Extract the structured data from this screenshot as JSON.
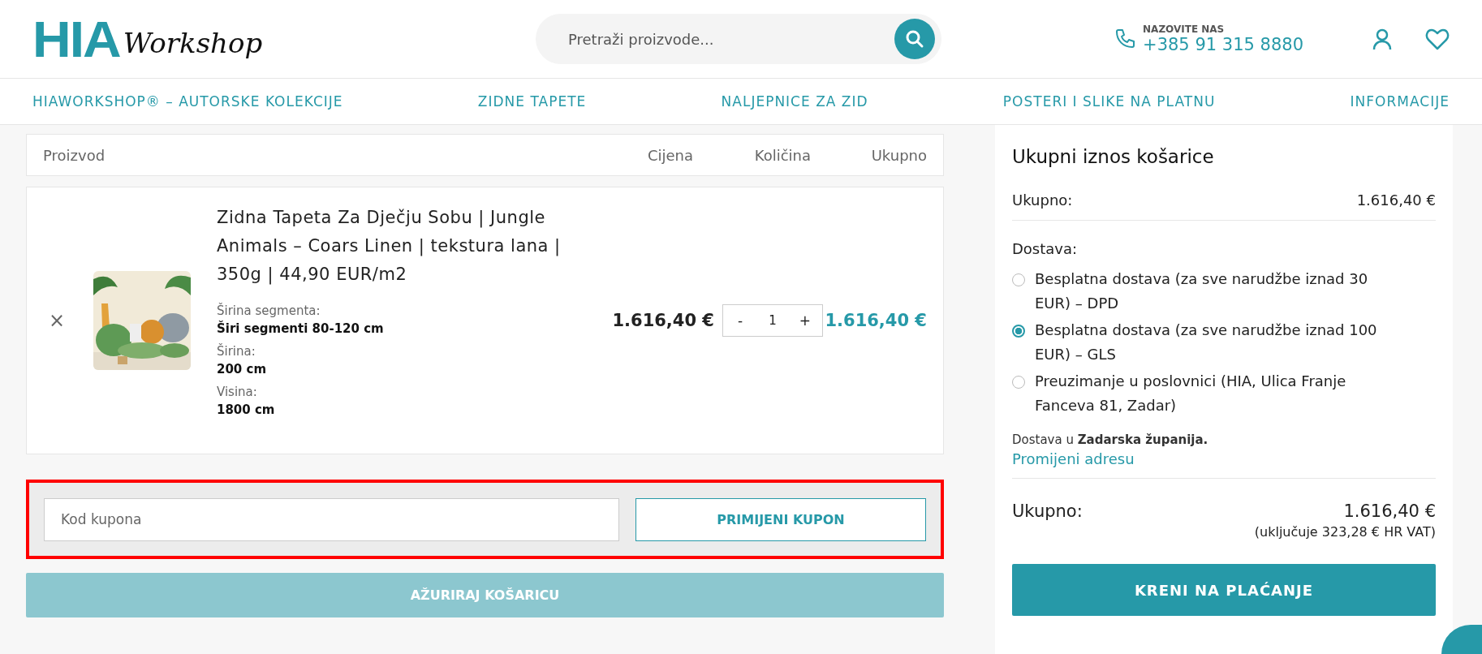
{
  "header": {
    "logo": {
      "main": "HIA",
      "script": "Workshop"
    },
    "search": {
      "placeholder": "Pretraži proizvode..."
    },
    "phone": {
      "label": "NAZOVITE NAS",
      "number": "+385 91 315 8880"
    }
  },
  "nav": [
    "HIAWORKSHOP® – AUTORSKE KOLEKCIJE",
    "ZIDNE TAPETE",
    "NALJEPNICE ZA ZID",
    "POSTERI I SLIKE NA PLATNU",
    "INFORMACIJE"
  ],
  "cart": {
    "columns": [
      "Proizvod",
      "Cijena",
      "Količina",
      "Ukupno"
    ],
    "items": [
      {
        "remove": "×",
        "title": "Zidna Tapeta Za Dječju Sobu | Jungle Animals – Coars Linen | tekstura lana | 350g | 44,90 EUR/m2",
        "image": {
          "kind": "picture"
        },
        "specs": [
          {
            "label": "Širina segmenta:",
            "value": "Širi segmenti 80-120 cm"
          },
          {
            "label": "Širina:",
            "value": "200 cm"
          },
          {
            "label": "Visina:",
            "value": "1800 cm"
          }
        ],
        "price": "1.616,40 €",
        "quantity": {
          "minus": "-",
          "value": "1",
          "plus": "+"
        },
        "total": "1.616,40 €"
      }
    ],
    "coupon": {
      "placeholder": "Kod kupona",
      "button": "PRIMIJENI KUPON",
      "highlighted": true
    },
    "update_button": {
      "label": "AŽURIRAJ KOŠARICU",
      "disabled": true
    }
  },
  "totals": {
    "title": "Ukupni iznos košarice",
    "subtotal_label": "Ukupno:",
    "subtotal": "1.616,40 €",
    "shipping_label": "Dostava:",
    "shipping_options": [
      {
        "label": "Besplatna dostava (za sve narudžbe iznad 30 EUR) – DPD",
        "selected": false
      },
      {
        "label": "Besplatna dostava (za sve narudžbe iznad 100 EUR) – GLS",
        "selected": true
      },
      {
        "label": "Preuzimanje u poslovnici (HIA, Ulica Franje Fanceva 81, Zadar)",
        "selected": false
      }
    ],
    "destination": "Dostava u **Zadarska županija.**",
    "change_address": "Promijeni adresu",
    "total_label": "Ukupno:",
    "total": "1.616,40 €",
    "vat_note": "(uključuje 323,28 € HR VAT)",
    "checkout_button": "KRENI NA PLAĆANJE"
  }
}
